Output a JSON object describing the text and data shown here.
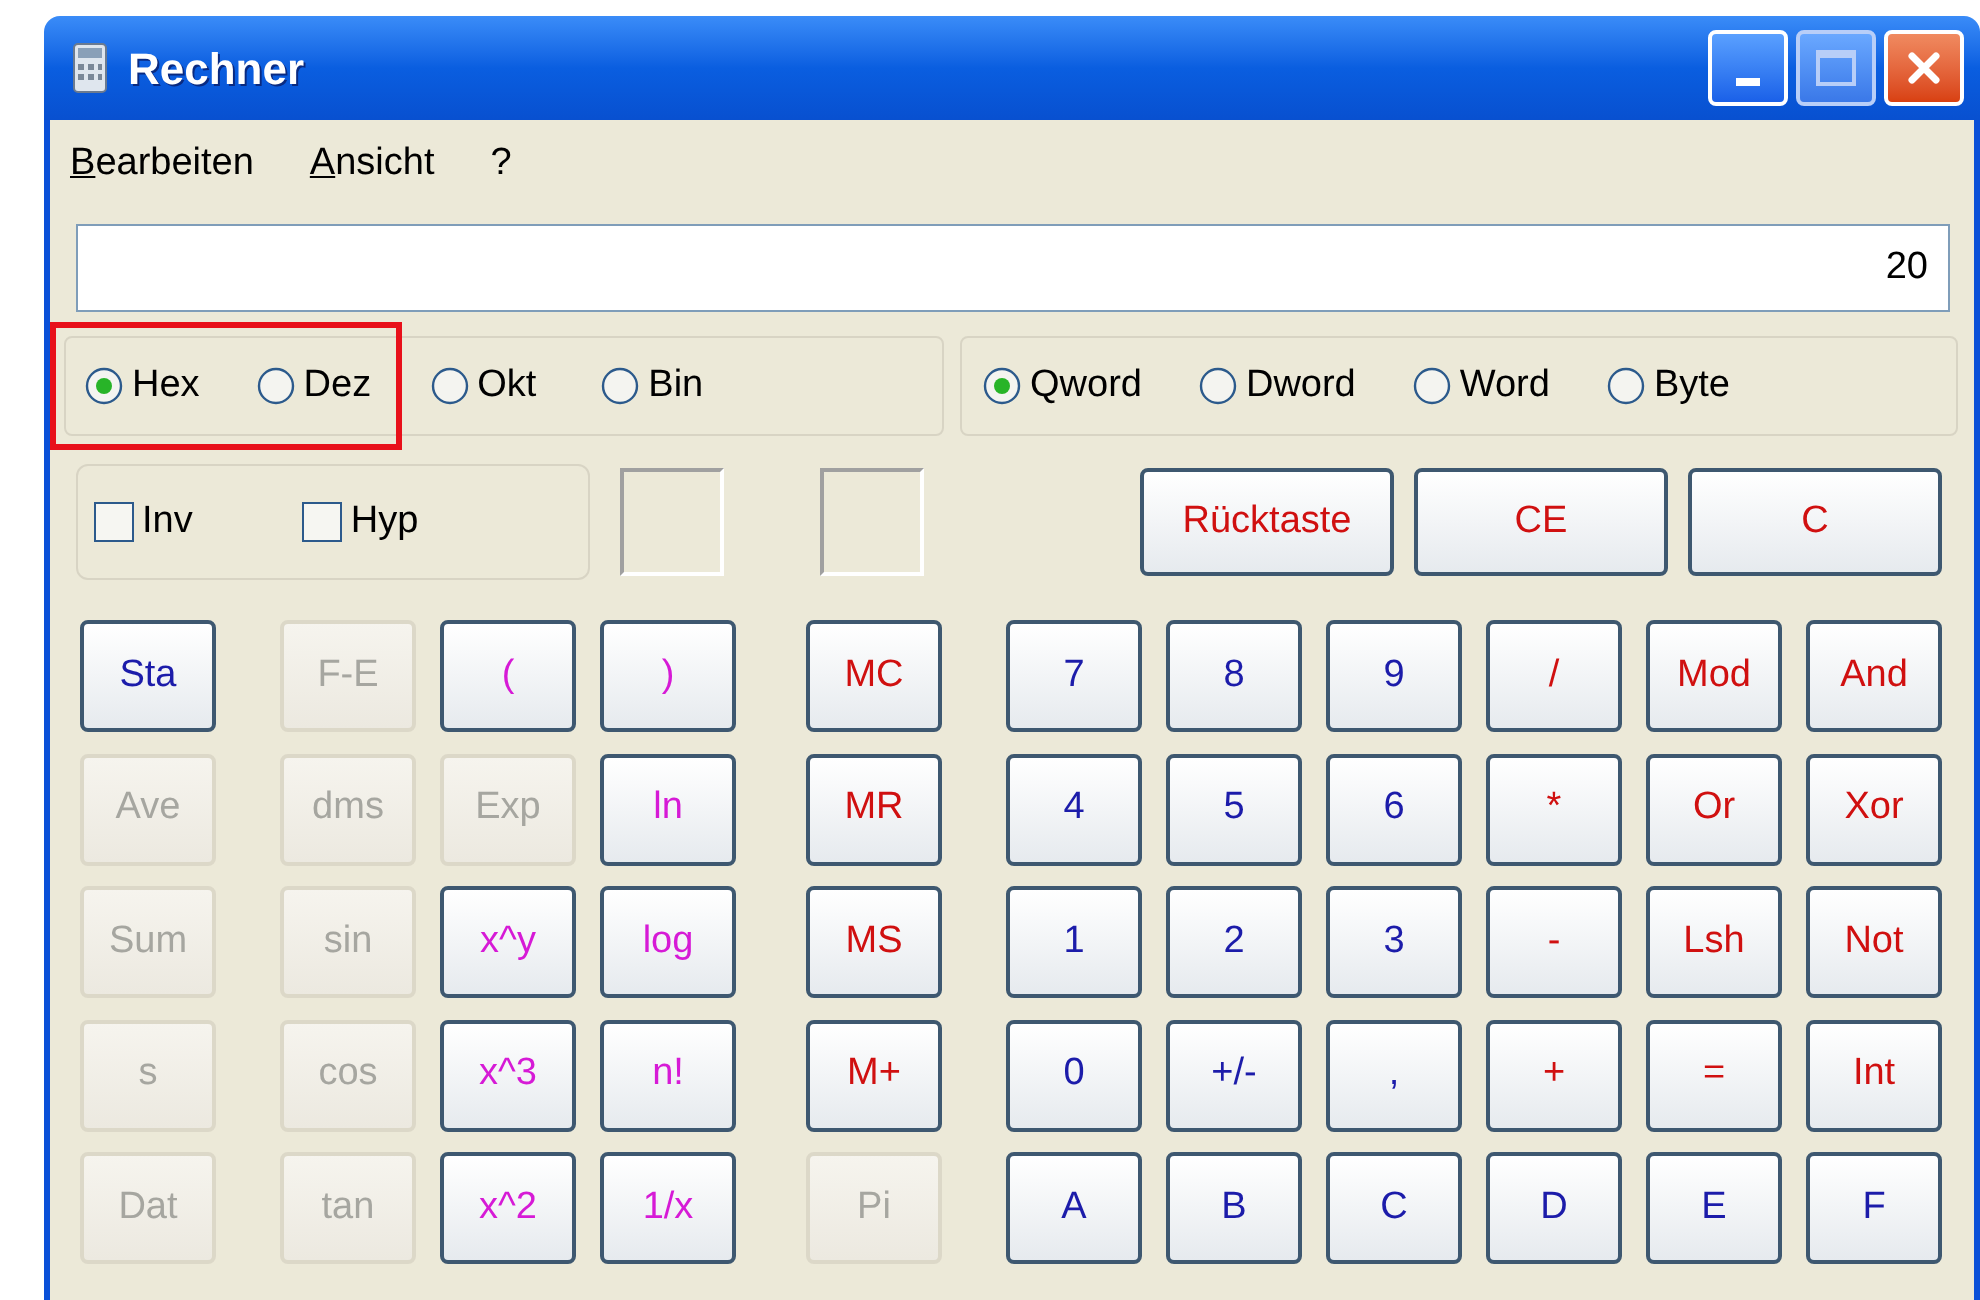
{
  "window": {
    "title": "Rechner"
  },
  "menu": [
    {
      "label": "Bearbeiten"
    },
    {
      "label": "Ansicht"
    },
    {
      "label": "?"
    }
  ],
  "display": {
    "value": "20"
  },
  "base": [
    {
      "label": "Hex",
      "selected": true,
      "highlighted": true
    },
    {
      "label": "Dez",
      "selected": false,
      "highlighted": true
    },
    {
      "label": "Okt",
      "selected": false,
      "highlighted": false
    },
    {
      "label": "Bin",
      "selected": false,
      "highlighted": false
    }
  ],
  "word_size": [
    {
      "label": "Qword",
      "selected": true
    },
    {
      "label": "Dword",
      "selected": false
    },
    {
      "label": "Word",
      "selected": false
    },
    {
      "label": "Byte",
      "selected": false
    }
  ],
  "options": [
    {
      "label": "Inv",
      "checked": false
    },
    {
      "label": "Hyp",
      "checked": false
    }
  ],
  "edit_keys": [
    {
      "label": "Rücktaste",
      "color": "#d01010"
    },
    {
      "label": "CE",
      "color": "#d01010"
    },
    {
      "label": "C",
      "color": "#d01010"
    }
  ],
  "left_keys": [
    [
      {
        "label": "Sta",
        "color": "#1c1caa",
        "disabled": false
      },
      {
        "label": "F-E",
        "disabled": true
      },
      {
        "label": "(",
        "color": "#d61ad6",
        "disabled": false
      },
      {
        "label": ")",
        "color": "#d61ad6",
        "disabled": false
      },
      {
        "label": "MC",
        "color": "#d01010",
        "disabled": false
      }
    ],
    [
      {
        "label": "Ave",
        "disabled": true
      },
      {
        "label": "dms",
        "disabled": true
      },
      {
        "label": "Exp",
        "disabled": true
      },
      {
        "label": "ln",
        "color": "#d61ad6",
        "disabled": false
      },
      {
        "label": "MR",
        "color": "#d01010",
        "disabled": false
      }
    ],
    [
      {
        "label": "Sum",
        "disabled": true
      },
      {
        "label": "sin",
        "disabled": true
      },
      {
        "label": "x^y",
        "color": "#d61ad6",
        "disabled": false
      },
      {
        "label": "log",
        "color": "#d61ad6",
        "disabled": false
      },
      {
        "label": "MS",
        "color": "#d01010",
        "disabled": false
      }
    ],
    [
      {
        "label": "s",
        "disabled": true
      },
      {
        "label": "cos",
        "disabled": true
      },
      {
        "label": "x^3",
        "color": "#d61ad6",
        "disabled": false
      },
      {
        "label": "n!",
        "color": "#d61ad6",
        "disabled": false
      },
      {
        "label": "M+",
        "color": "#d01010",
        "disabled": false
      }
    ],
    [
      {
        "label": "Dat",
        "disabled": true
      },
      {
        "label": "tan",
        "disabled": true
      },
      {
        "label": "x^2",
        "color": "#d61ad6",
        "disabled": false
      },
      {
        "label": "1/x",
        "color": "#d61ad6",
        "disabled": false
      },
      {
        "label": "Pi",
        "disabled": true
      }
    ]
  ],
  "right_keys": [
    [
      {
        "label": "7",
        "color": "#1c1caa",
        "disabled": false
      },
      {
        "label": "8",
        "color": "#1c1caa",
        "disabled": false
      },
      {
        "label": "9",
        "color": "#1c1caa",
        "disabled": false
      },
      {
        "label": "/",
        "color": "#d01010",
        "disabled": false
      },
      {
        "label": "Mod",
        "color": "#d01010",
        "disabled": false
      },
      {
        "label": "And",
        "color": "#d01010",
        "disabled": false
      }
    ],
    [
      {
        "label": "4",
        "color": "#1c1caa",
        "disabled": false
      },
      {
        "label": "5",
        "color": "#1c1caa",
        "disabled": false
      },
      {
        "label": "6",
        "color": "#1c1caa",
        "disabled": false
      },
      {
        "label": "*",
        "color": "#d01010",
        "disabled": false
      },
      {
        "label": "Or",
        "color": "#d01010",
        "disabled": false
      },
      {
        "label": "Xor",
        "color": "#d01010",
        "disabled": false
      }
    ],
    [
      {
        "label": "1",
        "color": "#1c1caa",
        "disabled": false
      },
      {
        "label": "2",
        "color": "#1c1caa",
        "disabled": false
      },
      {
        "label": "3",
        "color": "#1c1caa",
        "disabled": false
      },
      {
        "label": "-",
        "color": "#d01010",
        "disabled": false
      },
      {
        "label": "Lsh",
        "color": "#d01010",
        "disabled": false
      },
      {
        "label": "Not",
        "color": "#d01010",
        "disabled": false
      }
    ],
    [
      {
        "label": "0",
        "color": "#1c1caa",
        "disabled": false
      },
      {
        "label": "+/-",
        "color": "#1c1caa",
        "disabled": false
      },
      {
        "label": ",",
        "color": "#1c1caa",
        "disabled": false
      },
      {
        "label": "+",
        "color": "#d01010",
        "disabled": false
      },
      {
        "label": "=",
        "color": "#d01010",
        "disabled": false
      },
      {
        "label": "Int",
        "color": "#d01010",
        "disabled": false
      }
    ],
    [
      {
        "label": "A",
        "color": "#1c1caa",
        "disabled": false
      },
      {
        "label": "B",
        "color": "#1c1caa",
        "disabled": false
      },
      {
        "label": "C",
        "color": "#1c1caa",
        "disabled": false
      },
      {
        "label": "D",
        "color": "#1c1caa",
        "disabled": false
      },
      {
        "label": "E",
        "color": "#1c1caa",
        "disabled": false
      },
      {
        "label": "F",
        "color": "#1c1caa",
        "disabled": false
      }
    ]
  ]
}
